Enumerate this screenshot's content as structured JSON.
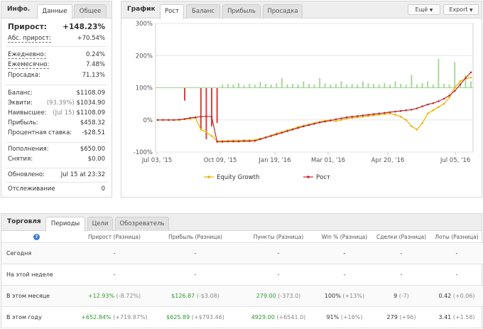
{
  "info": {
    "title": "Инфо.",
    "tabs": [
      "Данные",
      "Общее"
    ],
    "gain_label": "Прирост:",
    "gain_value": "+148.23%",
    "abs_gain_label": "Абс. прирост:",
    "abs_gain_value": "+70.54%",
    "daily_label": "Ежедневно:",
    "daily_value": "0.24%",
    "monthly_label": "Ежемесячно:",
    "monthly_value": "7.48%",
    "drawdown_label": "Просадка:",
    "drawdown_value": "71.13%",
    "balance_label": "Баланс:",
    "balance_value": "$1108.09",
    "equity_label": "Эквити:",
    "equity_pct": "(93.39%)",
    "equity_value": "$1034.90",
    "highest_label": "Наивысшее:",
    "highest_date": "(Jul 15)",
    "highest_value": "$1108.09",
    "profit_label": "Прибыль:",
    "profit_value": "$458.32",
    "interest_label": "Процентная ставка:",
    "interest_value": "-$28.51",
    "deposits_label": "Пополнения:",
    "deposits_value": "$650.00",
    "withdrawals_label": "Снятия:",
    "withdrawals_value": "$0.00",
    "updated_label": "Обновлено:",
    "updated_value": "Jul 15 at 23:32",
    "tracking_label": "Отслеживание",
    "tracking_value": "0"
  },
  "chart_panel": {
    "title": "График",
    "tabs": [
      "Рост",
      "Баланс",
      "Прибыль",
      "Просадка"
    ],
    "menu_button": "Ещё",
    "export_button": "Export"
  },
  "chart_data": {
    "type": "line",
    "y_ticks": [
      "300%",
      "200%",
      "100%",
      "0%",
      "-100%"
    ],
    "ylim": [
      -100,
      300
    ],
    "x_ticks": [
      "Jul 03, '15",
      "Oct 09, '15",
      "Jan 19, '16",
      "Mar 01, '16",
      "Apr 20, '16",
      "Jul 05, '16"
    ],
    "legend": [
      "Equity Growth",
      "Рост"
    ],
    "colors": {
      "equity": "#e8b400",
      "growth": "#c0282d",
      "bar_up": "#a6d99a",
      "bar_down": "#d9403a"
    },
    "grid": true,
    "series": [
      {
        "name": "Рост",
        "values": [
          0,
          0,
          0,
          0,
          1,
          3,
          6,
          8,
          10,
          11,
          10,
          -68,
          -68,
          -67,
          -67,
          -67,
          -66,
          -66,
          -65,
          -60,
          -55,
          -50,
          -45,
          -40,
          -35,
          -30,
          -25,
          -20,
          -16,
          -12,
          -8,
          -5,
          -2,
          2,
          5,
          8,
          10,
          12,
          14,
          16,
          18,
          20,
          22,
          24,
          26,
          28,
          30,
          32,
          36,
          42,
          48,
          52,
          58,
          66,
          76,
          90,
          110,
          130,
          148
        ]
      },
      {
        "name": "Equity Growth",
        "values": [
          0,
          0,
          0,
          0,
          0,
          2,
          4,
          6,
          -30,
          -38,
          -50,
          -65,
          -65,
          -65,
          -64,
          -64,
          -63,
          -63,
          -62,
          -58,
          -54,
          -48,
          -42,
          -38,
          -32,
          -28,
          -22,
          -18,
          -14,
          -10,
          -6,
          -2,
          0,
          -4,
          0,
          4,
          6,
          8,
          10,
          12,
          14,
          16,
          18,
          20,
          16,
          10,
          0,
          -20,
          -30,
          -10,
          20,
          30,
          40,
          50,
          70,
          100,
          120,
          128,
          132
        ]
      }
    ],
    "bars": [
      0,
      0,
      0,
      0,
      0,
      -40,
      0,
      0,
      -130,
      -160,
      -120,
      -110,
      10,
      12,
      10,
      14,
      8,
      12,
      10,
      18,
      12,
      10,
      14,
      30,
      10,
      12,
      10,
      20,
      12,
      10,
      30,
      14,
      10,
      12,
      20,
      10,
      12,
      10,
      20,
      14,
      12,
      10,
      15,
      10,
      20,
      12,
      10,
      40,
      10,
      14,
      20,
      10,
      90,
      12,
      10,
      80,
      14,
      40,
      20
    ]
  },
  "trading": {
    "title": "Торговля",
    "tabs": [
      "Периоды",
      "Цели",
      "Обозреватель"
    ],
    "columns": [
      "Прирост (Разница)",
      "Прибыль (Разница)",
      "Пункты (Разница)",
      "Win % (Разница)",
      "Сделки (Разница)",
      "Лоты (Разница)"
    ],
    "rows": [
      {
        "period": "Сегодня",
        "gain": "-",
        "gain_diff": "",
        "profit": "-",
        "profit_diff": "",
        "pips": "-",
        "pips_diff": "",
        "win": "-",
        "win_diff": "",
        "trades": "-",
        "trades_diff": "",
        "lots": "-",
        "lots_diff": ""
      },
      {
        "period": "На этой неделе",
        "gain": "-",
        "gain_diff": "",
        "profit": "-",
        "profit_diff": "",
        "pips": "-",
        "pips_diff": "",
        "win": "-",
        "win_diff": "",
        "trades": "-",
        "trades_diff": "",
        "lots": "-",
        "lots_diff": ""
      },
      {
        "period": "В этом месяце",
        "gain": "+12.93%",
        "gain_diff": "(-8.72%)",
        "profit": "$126.87",
        "profit_diff": "(-$3.08)",
        "pips": "279.00",
        "pips_diff": "(-373.0)",
        "win": "100%",
        "win_diff": "(+13%)",
        "trades": "9",
        "trades_diff": "(-7)",
        "lots": "0.42",
        "lots_diff": "(+0.06)"
      },
      {
        "period": "В этом году",
        "gain": "+652.84%",
        "gain_diff": "(+719.87%)",
        "profit": "$625.89",
        "profit_diff": "(+$793.46)",
        "pips": "4929.00",
        "pips_diff": "(+6541.0)",
        "win": "91%",
        "win_diff": "(+16%)",
        "trades": "279",
        "trades_diff": "(+96)",
        "lots": "3.41",
        "lots_diff": "(+1.58)"
      }
    ]
  }
}
